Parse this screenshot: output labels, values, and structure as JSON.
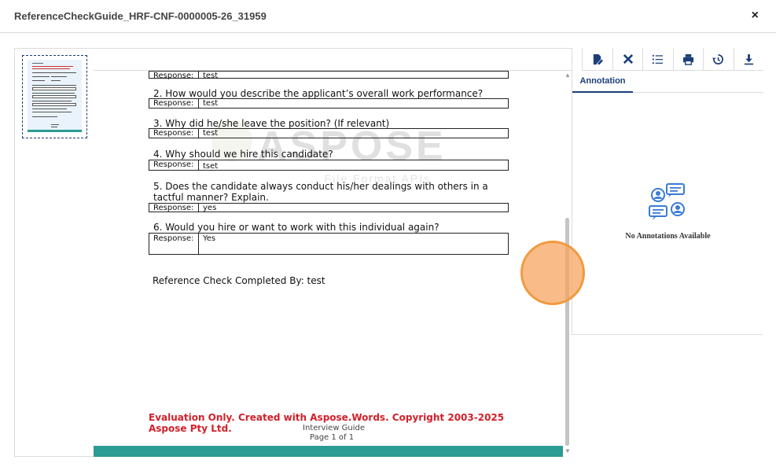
{
  "window": {
    "title": "ReferenceCheckGuide_HRF-CNF-0000005-26_31959",
    "close_label": "×"
  },
  "document": {
    "watermark": "ASPOSE",
    "watermark_sub": "... File Format APIs",
    "questions": [
      {
        "text": "",
        "response_label": "Response:",
        "response": "test"
      },
      {
        "text": "2. How would you describe the applicant’s overall work performance?",
        "response_label": "Response:",
        "response": "test"
      },
      {
        "text": "3. Why did he/she leave the position? (If relevant)",
        "response_label": "Response:",
        "response": "test"
      },
      {
        "text": "4. Why should we hire this candidate?",
        "response_label": "Response:",
        "response": "tset"
      },
      {
        "text": "5. Does the candidate always conduct his/her dealings with others in a",
        "text2": "tactful manner? Explain.",
        "response_label": "Response:",
        "response": "yes"
      },
      {
        "text": "6. Would you hire or want to work with this individual again?",
        "response_label": "Response:",
        "response": "Yes"
      }
    ],
    "completed_by": "Reference Check Completed By: test",
    "evaluation_line1": "Evaluation Only. Created with Aspose.Words. Copyright 2003-2025",
    "evaluation_line2": "Aspose Pty Ltd.",
    "footer_title": "Interview Guide",
    "footer_page": "Page 1 of 1"
  },
  "right_panel": {
    "icons": [
      "edit-document-icon",
      "tools-icon",
      "list-icon",
      "print-icon",
      "history-icon",
      "download-icon"
    ],
    "tab_label": "Annotation",
    "empty_text": "No Annotations Available"
  },
  "colors": {
    "accent": "#1c3f7a",
    "teal": "#2a9c94",
    "evaluation_red": "#d3202a",
    "cursor_orange": "#f09a3e"
  }
}
